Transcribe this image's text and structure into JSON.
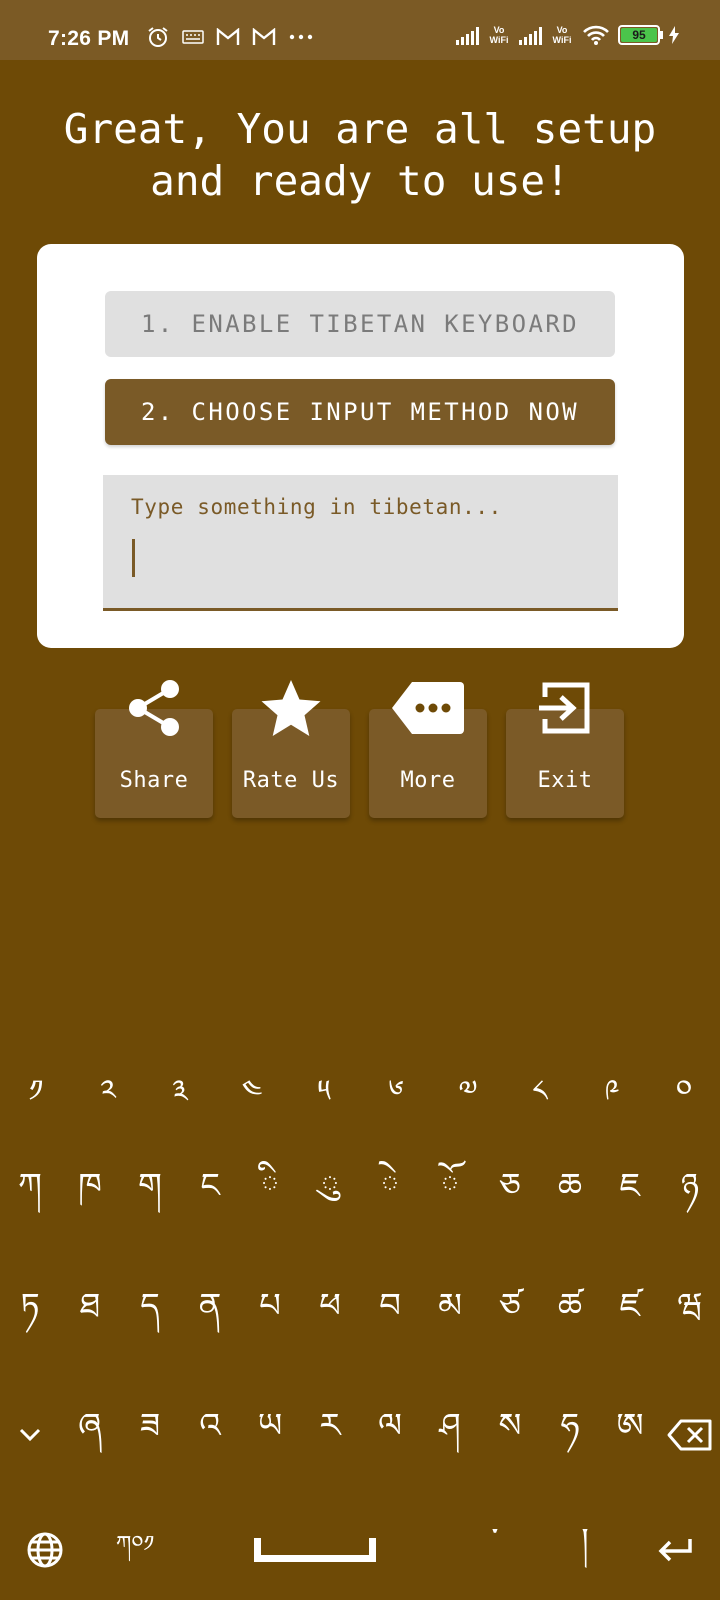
{
  "status_bar": {
    "time": "7:26 PM",
    "left_icons": [
      "alarm-icon",
      "keyboard-icon",
      "gmail-icon",
      "gmail-icon",
      "more-dots-icon"
    ],
    "vowifi_1": "Vo WiFi",
    "vowifi_2": "Vo WiFi",
    "battery": "95"
  },
  "headline": {
    "line1": "Great, You are all setup",
    "line2": "and ready to use!"
  },
  "card": {
    "enable_button": "1. ENABLE TIBETAN KEYBOARD",
    "choose_button": "2. CHOOSE INPUT METHOD NOW",
    "input_placeholder": "Type something in tibetan..."
  },
  "actions": [
    {
      "label": "Share",
      "icon": "share-icon"
    },
    {
      "label": "Rate Us",
      "icon": "star-icon"
    },
    {
      "label": "More",
      "icon": "more-tag-icon"
    },
    {
      "label": "Exit",
      "icon": "exit-icon"
    }
  ],
  "colors": {
    "background": "#6e4a06",
    "accent": "#7a5a27",
    "status_bar": "#7b5a25"
  },
  "keyboard": {
    "row1": [
      "༡",
      "༢",
      "༣",
      "༤",
      "༥",
      "༦",
      "༧",
      "༨",
      "༩",
      "༠"
    ],
    "row2": [
      "ཀ",
      "ཁ",
      "ག",
      "ང",
      "◌ི",
      "◌ུ",
      "◌ེ",
      "◌ོ",
      "ཅ",
      "ཆ",
      "ཇ",
      "ཉ"
    ],
    "row3": [
      "ཏ",
      "ཐ",
      "ད",
      "ན",
      "པ",
      "ཕ",
      "བ",
      "མ",
      "ཙ",
      "ཚ",
      "ཛ",
      "ཝ"
    ],
    "row4": [
      "ཞ",
      "ཟ",
      "འ",
      "ཡ",
      "ར",
      "ལ",
      "ཤ",
      "ས",
      "ཧ",
      "ཨ"
    ],
    "row5": {
      "lang_key": "ཀ༠༡",
      "tsheg": "་",
      "shad": "།"
    }
  }
}
